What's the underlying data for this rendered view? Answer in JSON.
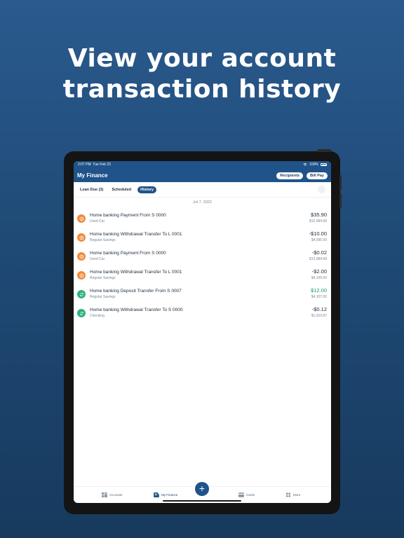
{
  "headline": {
    "line1": "View your account",
    "line2": "transaction history"
  },
  "status": {
    "time": "2:07 PM",
    "day": "Tue Feb 23",
    "battery": "100%"
  },
  "nav": {
    "title": "My Finance",
    "recipients": "Recipients",
    "bill_pay": "Bill Pay"
  },
  "tabs": [
    {
      "label": "Loan Due (3)"
    },
    {
      "label": "Scheduled"
    },
    {
      "label": "History"
    }
  ],
  "date_header": "Jul 7, 2022",
  "transactions": [
    {
      "title": "Home banking Payment From S 0000",
      "account": "Used Car",
      "amount": "$35.90",
      "balance": "$12,984.68",
      "icon": "orange"
    },
    {
      "title": "Home banking Withdrawal Transfer To L 0001",
      "account": "Regular Savings",
      "amount": "-$10.00",
      "balance": "$4,095.00",
      "icon": "orange"
    },
    {
      "title": "Home banking Payment From S 0000",
      "account": "Used Car",
      "amount": "-$0.02",
      "balance": "$12,984.68",
      "icon": "orange"
    },
    {
      "title": "Home banking Withdrawal Transfer To L 0001",
      "account": "Regular Savings",
      "amount": "-$2.00",
      "balance": "$4,105.00",
      "icon": "orange"
    },
    {
      "title": "Home banking Deposit Transfer From S 0007",
      "account": "Regular Savings",
      "amount": "$12.00",
      "balance": "$4,107.00",
      "icon": "green"
    },
    {
      "title": "Home banking Withdrawal Transfer To S 0000",
      "account": "Checking",
      "amount": "-$0.12",
      "balance": "$1,910.87",
      "icon": "green"
    }
  ],
  "bottom_nav": {
    "accounts": "Accounts",
    "my_finance": "My Finance",
    "cards": "Cards",
    "more": "More"
  },
  "colors": {
    "primary": "#1f5389",
    "orange": "#f08a3a",
    "green": "#2fb27a",
    "positive": "#1e9a5c"
  }
}
